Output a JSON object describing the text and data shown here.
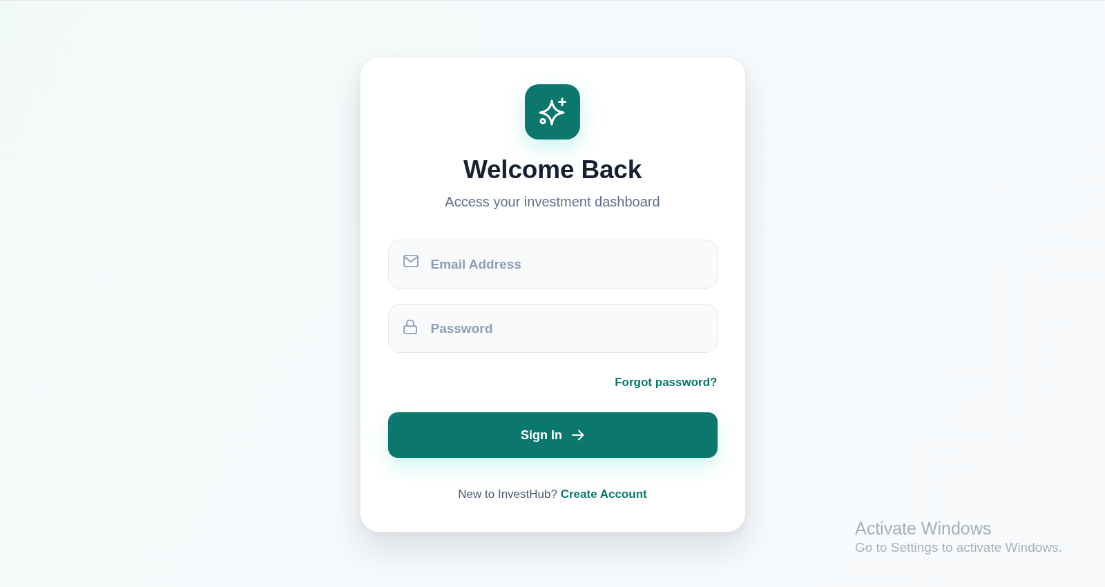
{
  "heading": "Welcome Back",
  "subheading": "Access your investment dashboard",
  "fields": [
    {
      "kind": "email",
      "placeholder": "Email Address"
    },
    {
      "kind": "password",
      "placeholder": "Password"
    }
  ],
  "forgot_link": "Forgot password?",
  "submit_button": {
    "label": "Sign In"
  },
  "signup_prompt": {
    "text": "New to InvestHub?",
    "link": "Create Account"
  },
  "os_notice": {
    "title": "Activate Windows",
    "text": "Go to Settings to activate Windows."
  }
}
